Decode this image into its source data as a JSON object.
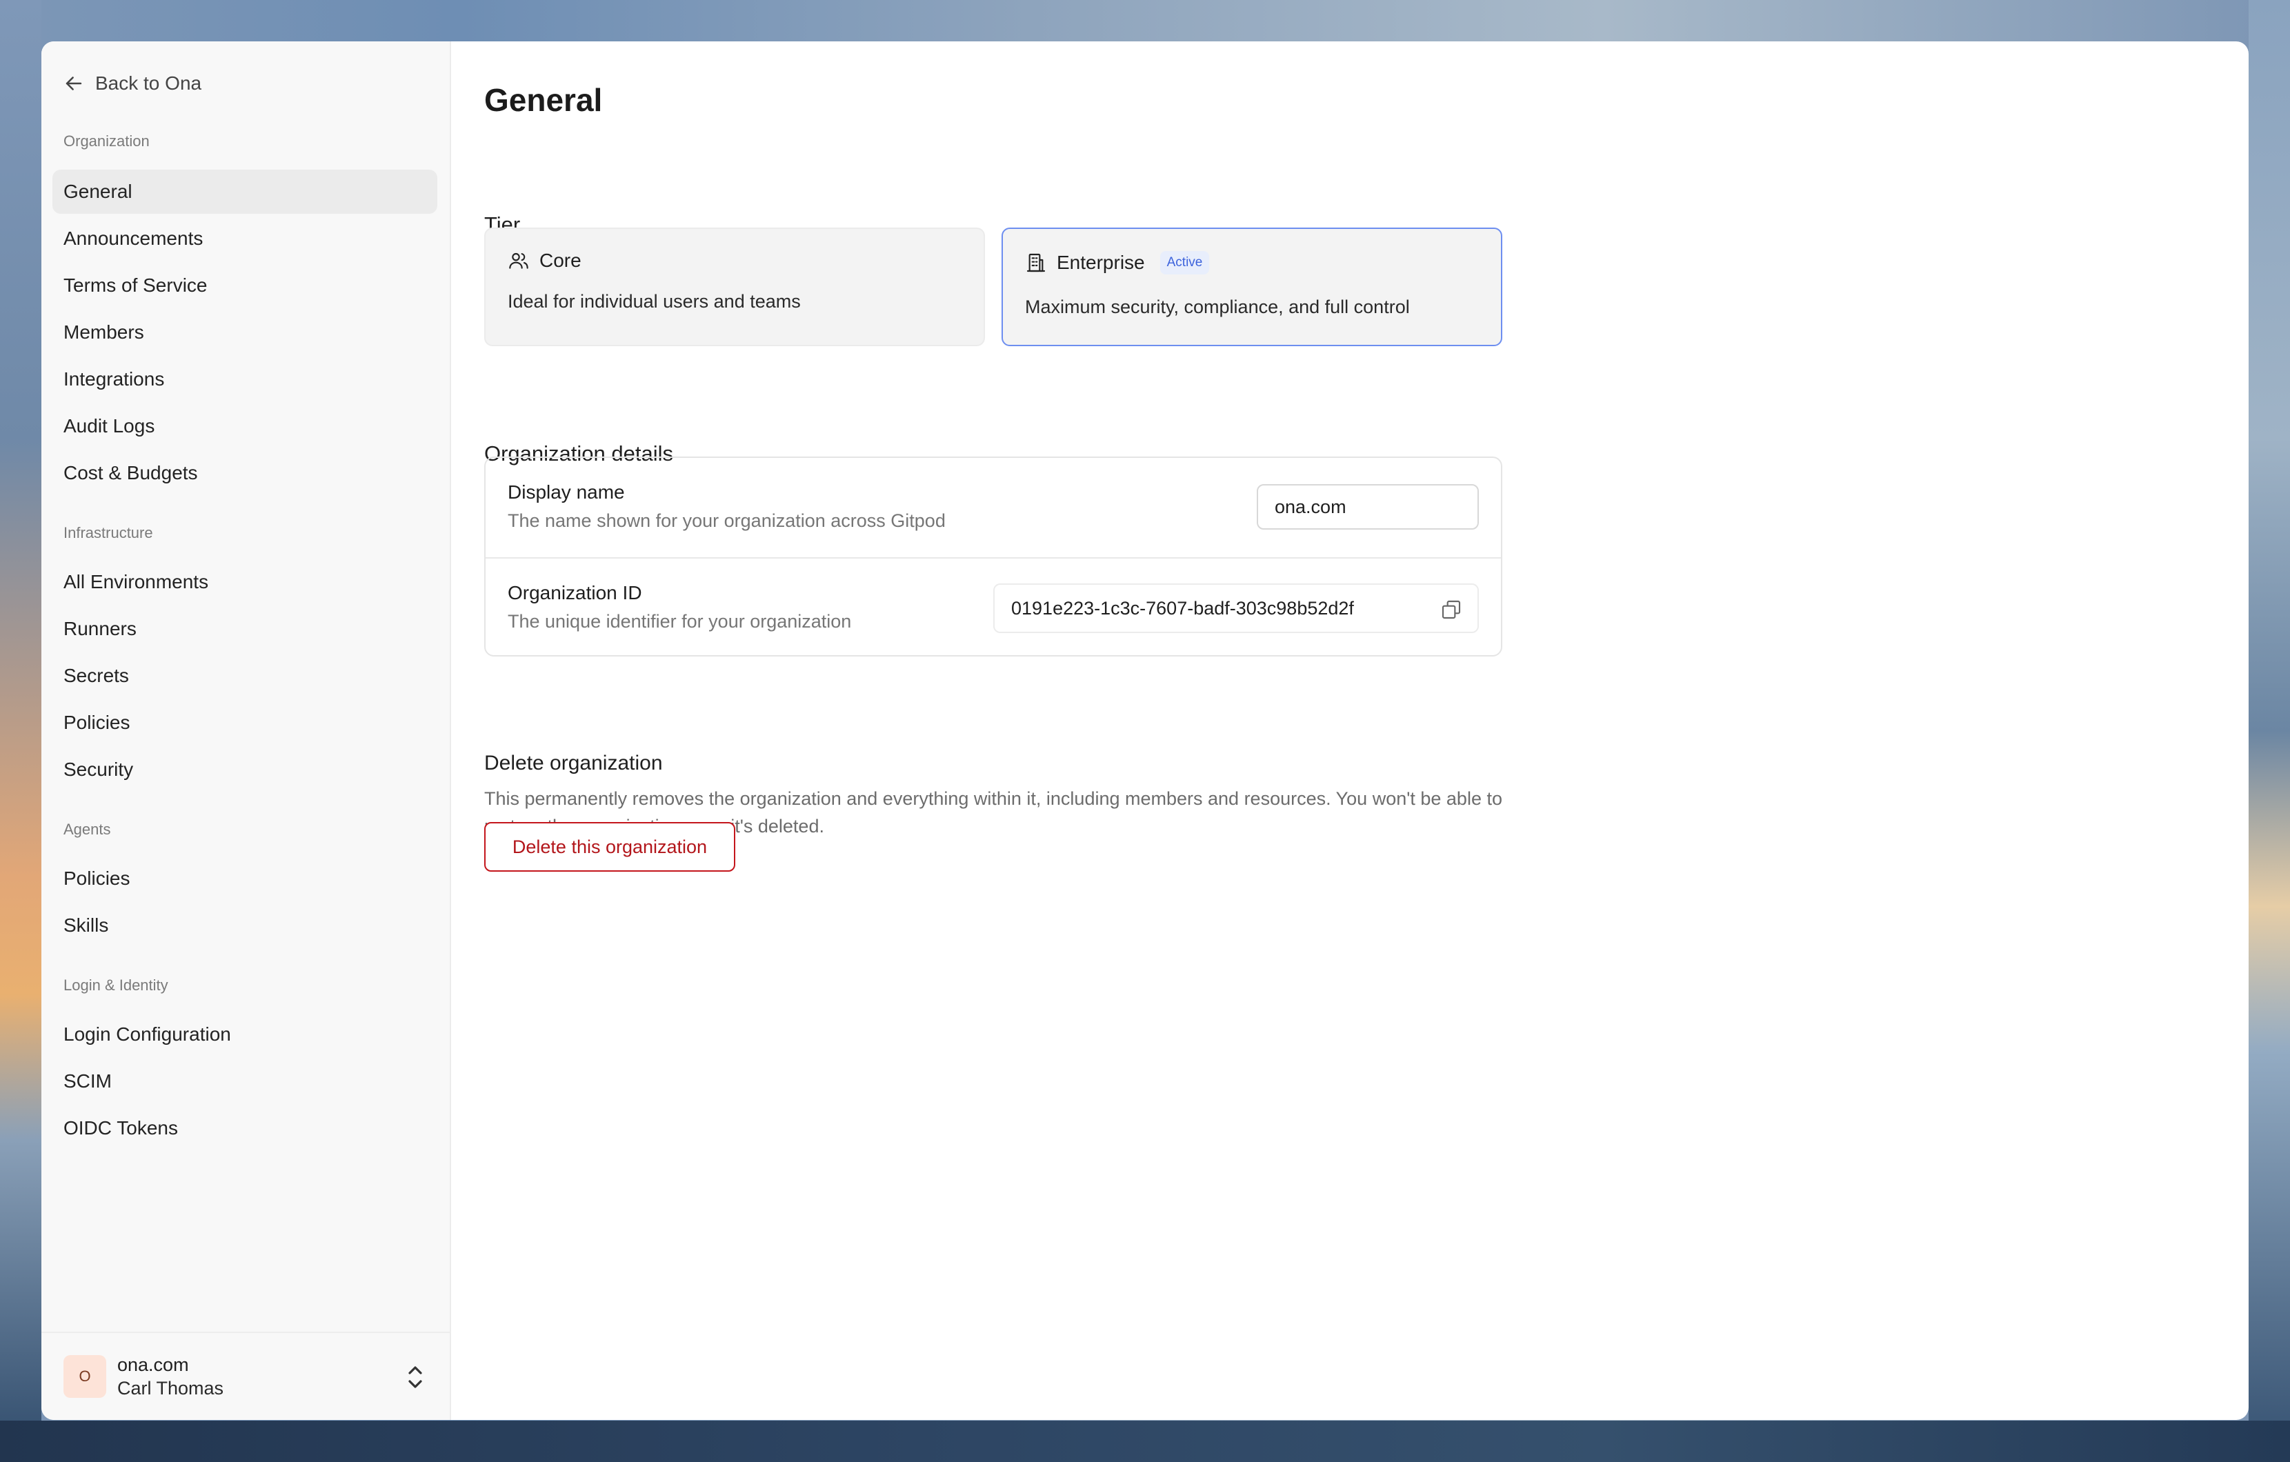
{
  "sidebar": {
    "back_label": "Back to Ona",
    "sections": {
      "organization": "Organization",
      "infrastructure": "Infrastructure",
      "agents": "Agents",
      "login_identity": "Login & Identity"
    },
    "items": {
      "general": "General",
      "announcements": "Announcements",
      "terms": "Terms of Service",
      "members": "Members",
      "integrations": "Integrations",
      "audit_logs": "Audit Logs",
      "cost_budgets": "Cost & Budgets",
      "all_environments": "All Environments",
      "runners": "Runners",
      "secrets": "Secrets",
      "infra_policies": "Policies",
      "security": "Security",
      "agent_policies": "Policies",
      "skills": "Skills",
      "login_configuration": "Login Configuration",
      "scim": "SCIM",
      "oidc_tokens": "OIDC Tokens"
    },
    "user": {
      "avatar_letter": "O",
      "org": "ona.com",
      "name": "Carl Thomas"
    }
  },
  "main": {
    "title": "General",
    "tier": {
      "heading": "Tier",
      "core": {
        "name": "Core",
        "description": "Ideal for individual users and teams",
        "icon": "users-icon"
      },
      "enterprise": {
        "name": "Enterprise",
        "badge": "Active",
        "description": "Maximum security, compliance, and full control",
        "icon": "building-icon"
      }
    },
    "details": {
      "heading": "Organization details",
      "display_name": {
        "label": "Display name",
        "sublabel": "The name shown for your organization across Gitpod",
        "value": "ona.com"
      },
      "org_id": {
        "label": "Organization ID",
        "sublabel": "The unique identifier for your organization",
        "value": "0191e223-1c3c-7607-badf-303c98b52d2f"
      }
    },
    "delete": {
      "heading": "Delete organization",
      "description": "This permanently removes the organization and everything within it, including members and resources. You won't be able to restore the organization once it's deleted.",
      "button_label": "Delete this organization"
    }
  },
  "colors": {
    "accent_blue": "#6d8ef0",
    "danger": "#c4161c",
    "active_badge": "#3d63dc"
  }
}
